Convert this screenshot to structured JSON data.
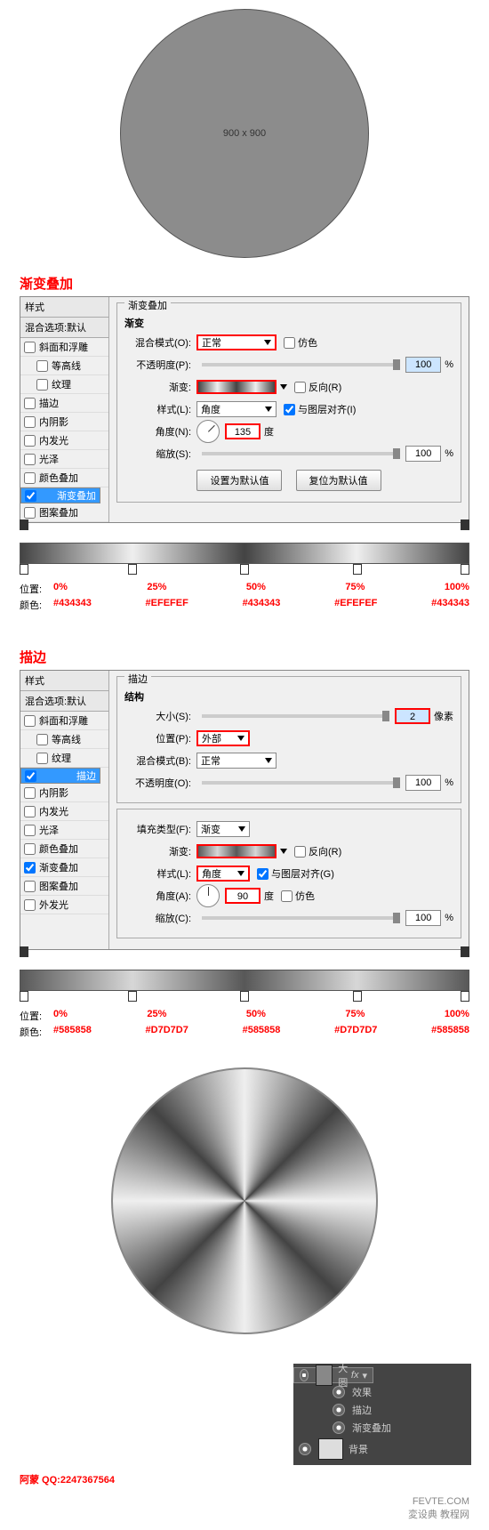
{
  "circle_label": "900 x 900",
  "section1_title": "渐变叠加",
  "section2_title": "描边",
  "styles_header": "样式",
  "blend_defaults": "混合选项:默认",
  "style_items": {
    "bevel": "斜面和浮雕",
    "contour": "等高线",
    "texture": "纹理",
    "stroke": "描边",
    "inner_shadow": "内阴影",
    "inner_glow": "内发光",
    "satin": "光泽",
    "color_overlay": "颜色叠加",
    "gradient_overlay": "渐变叠加",
    "pattern_overlay": "图案叠加",
    "outer_glow": "外发光"
  },
  "panel1": {
    "title": "渐变叠加",
    "subtitle": "渐变",
    "blend_mode_label": "混合模式(O):",
    "blend_mode_value": "正常",
    "dither": "仿色",
    "opacity_label": "不透明度(P):",
    "opacity_value": "100",
    "pct": "%",
    "gradient_label": "渐变:",
    "reverse": "反向(R)",
    "style_label": "样式(L):",
    "style_value": "角度",
    "align_layer": "与图层对齐(I)",
    "angle_label": "角度(N):",
    "angle_value": "135",
    "degree": "度",
    "scale_label": "缩放(S):",
    "scale_value": "100",
    "btn_default": "设置为默认值",
    "btn_reset": "复位为默认值"
  },
  "panel2": {
    "title": "描边",
    "structure": "结构",
    "size_label": "大小(S):",
    "size_value": "2",
    "px": "像素",
    "position_label": "位置(P):",
    "position_value": "外部",
    "blend_mode_label": "混合模式(B):",
    "blend_mode_value": "正常",
    "opacity_label": "不透明度(O):",
    "opacity_value": "100",
    "pct": "%",
    "fill_type_label": "填充类型(F):",
    "fill_type_value": "渐变",
    "gradient_label": "渐变:",
    "reverse": "反向(R)",
    "style_label": "样式(L):",
    "style_value": "角度",
    "align_layer": "与图层对齐(G)",
    "angle_label": "角度(A):",
    "angle_value": "90",
    "degree": "度",
    "dither": "仿色",
    "scale_label": "缩放(C):",
    "scale_value": "100"
  },
  "stops1": {
    "position_label": "位置:",
    "color_label": "颜色:",
    "items": [
      {
        "pos": "0%",
        "color": "#434343"
      },
      {
        "pos": "25%",
        "color": "#EFEFEF"
      },
      {
        "pos": "50%",
        "color": "#434343"
      },
      {
        "pos": "75%",
        "color": "#EFEFEF"
      },
      {
        "pos": "100%",
        "color": "#434343"
      }
    ]
  },
  "stops2": {
    "position_label": "位置:",
    "color_label": "颜色:",
    "items": [
      {
        "pos": "0%",
        "color": "#585858"
      },
      {
        "pos": "25%",
        "color": "#D7D7D7"
      },
      {
        "pos": "50%",
        "color": "#585858"
      },
      {
        "pos": "75%",
        "color": "#D7D7D7"
      },
      {
        "pos": "100%",
        "color": "#585858"
      }
    ]
  },
  "layers": {
    "name": "大圆",
    "effects": "效果",
    "stroke": "描边",
    "grad": "渐变叠加",
    "bg": "背景",
    "fx": "fx"
  },
  "footer": "阿蒙 QQ:2247367564",
  "watermark1": "FEVTE.COM",
  "watermark2": "変设典 教程网"
}
